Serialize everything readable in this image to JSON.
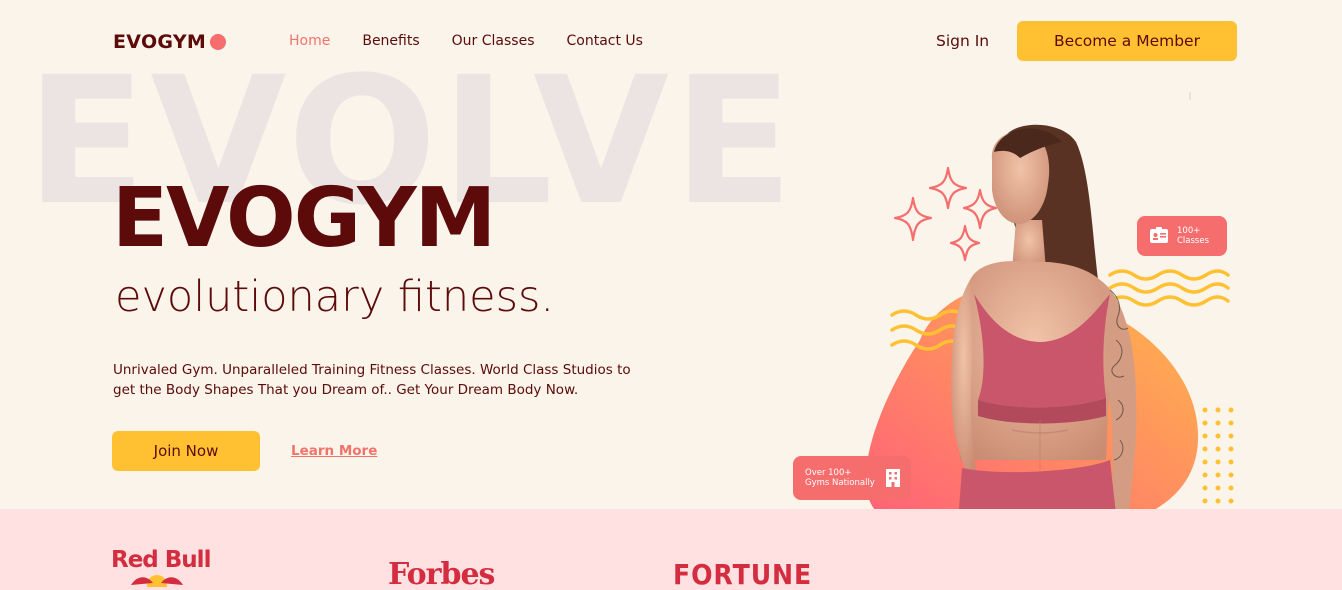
{
  "nav": {
    "logo_text": "EVOGYM",
    "links": [
      {
        "label": "Home",
        "active": true
      },
      {
        "label": "Benefits",
        "active": false
      },
      {
        "label": "Our Classes",
        "active": false
      },
      {
        "label": "Contact Us",
        "active": false
      }
    ],
    "sign_in": "Sign In",
    "member_button": "Become a Member"
  },
  "hero": {
    "background_word": "EVOLVE",
    "title": "EVOGYM",
    "subtitle": "evolutionary fitness.",
    "description": "Unrivaled Gym. Unparalleled Training Fitness Classes. World Class Studios to get the Body Shapes That you Dream of.. Get Your Dream Body Now.",
    "join_button": "Join Now",
    "learn_link": "Learn More"
  },
  "badges": {
    "classes_line1": "100+",
    "classes_line2": "Classes",
    "gyms_line1": "Over 100+",
    "gyms_line2": "Gyms Nationally",
    "classes_icon": "id-card-icon",
    "gyms_icon": "building-icon"
  },
  "sponsors": [
    "Red Bull",
    "Forbes",
    "FORTUNE"
  ],
  "colors": {
    "primary_text": "#5c0a0a",
    "accent_coral": "#f66d6d",
    "accent_yellow": "#ffc132",
    "background": "#faf4ea",
    "sponsor_band": "#ffe1e1"
  }
}
